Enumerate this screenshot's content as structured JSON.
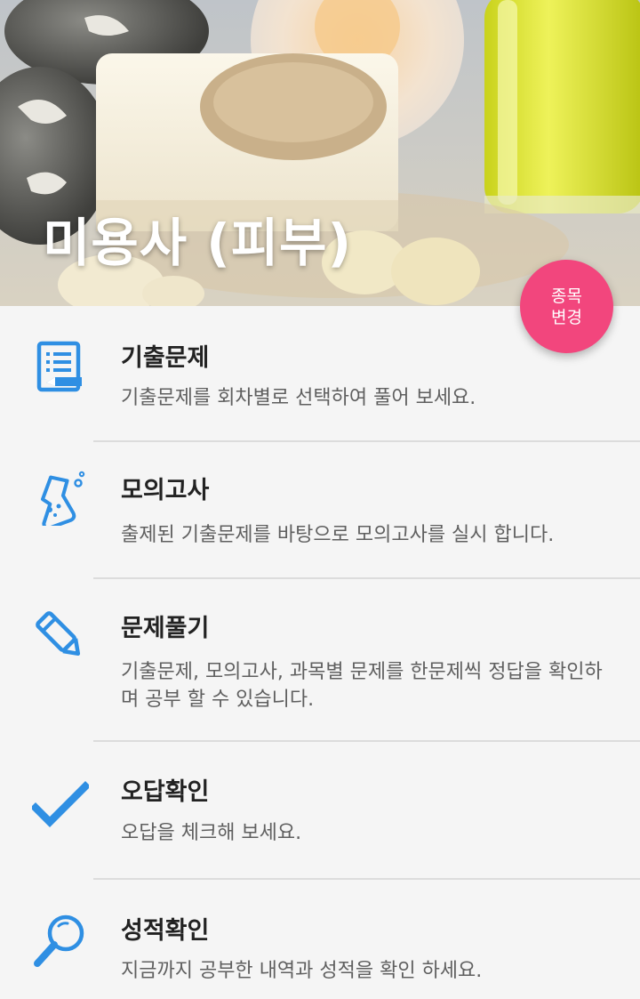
{
  "header": {
    "title": "미용사 (피부)"
  },
  "fab": {
    "line1": "종목",
    "line2": "변경"
  },
  "menu": {
    "items": [
      {
        "icon": "notebook-icon",
        "title": "기출문제",
        "desc": "기출문제를 회차별로 선택하여 풀어 보세요."
      },
      {
        "icon": "flask-icon",
        "title": "모의고사",
        "desc": "출제된 기출문제를 바탕으로 모의고사를 실시 합니다."
      },
      {
        "icon": "pencil-icon",
        "title": "문제풀기",
        "desc": "기출문제, 모의고사, 과목별 문제를 한문제씩 정답을 확인하며 공부 할 수 있습니다."
      },
      {
        "icon": "checkmark-icon",
        "title": "오답확인",
        "desc": "오답을 체크해 보세요."
      },
      {
        "icon": "magnifier-icon",
        "title": "성적확인",
        "desc": "지금까지 공부한 내역과 성적을 확인 하세요."
      }
    ]
  },
  "colors": {
    "accent": "#2f8fe3",
    "fab": "#f2467d",
    "title_text": "#222222",
    "desc_text": "#5f5f5f",
    "divider": "#dcdcdc",
    "background": "#f5f5f5"
  }
}
